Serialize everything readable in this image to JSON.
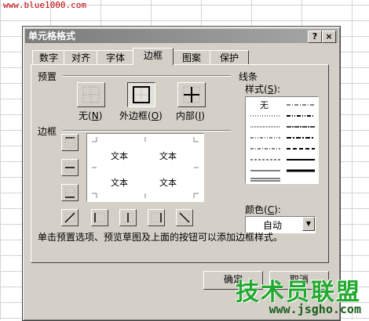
{
  "watermark_top": "www.blue1000.com",
  "dialog": {
    "title": "单元格格式",
    "help": "?",
    "close": "×"
  },
  "tabs": [
    "数字",
    "对齐",
    "字体",
    "边框",
    "图案",
    "保护"
  ],
  "active_tab": "边框",
  "presets": {
    "label": "预置",
    "none": "无",
    "none_key": "N",
    "outline": "外边框",
    "outline_key": "O",
    "inside": "内部",
    "inside_key": "I"
  },
  "border": {
    "label": "边框",
    "preview_texts": [
      "文本",
      "文本",
      "文本",
      "文本"
    ]
  },
  "line": {
    "label": "线条",
    "style_label": "样式",
    "style_key": "S",
    "none_style": "无",
    "color_label": "颜色",
    "color_key": "C",
    "color_value": "自动"
  },
  "hint": "单击预置选项、预览草图及上面的按钮可以添加边框样式。",
  "buttons": {
    "ok": "确定",
    "cancel": "取消"
  },
  "watermark_bottom": {
    "logo": "技术员联盟",
    "url": "www.jsgho.com"
  }
}
